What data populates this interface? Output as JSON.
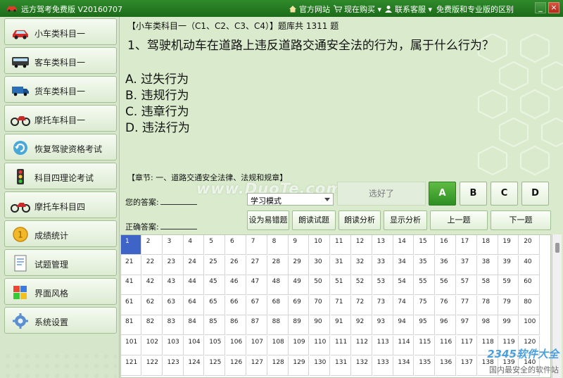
{
  "window": {
    "title": "远方驾考免费版 V20160707",
    "menu": [
      {
        "label": "官方网站",
        "icon": "home-icon"
      },
      {
        "label": "现在购买",
        "icon": "cart-icon"
      },
      {
        "label": "联系客服",
        "icon": "contact-icon"
      },
      {
        "label": "免费版和专业版的区别",
        "icon": ""
      }
    ],
    "controls": {
      "minimize": "_",
      "close": "×"
    }
  },
  "sidebar": {
    "items": [
      {
        "label": "小车类科目一",
        "icon": "car-icon"
      },
      {
        "label": "客车类科目一",
        "icon": "bus-icon"
      },
      {
        "label": "货车类科目一",
        "icon": "truck-icon"
      },
      {
        "label": "摩托车科目一",
        "icon": "motorcycle-icon"
      },
      {
        "label": "恢复驾驶资格考试",
        "icon": "refresh-icon"
      },
      {
        "label": "科目四理论考试",
        "icon": "traffic-light-icon"
      },
      {
        "label": "摩托车科目四",
        "icon": "motorcycle-icon"
      },
      {
        "label": "成绩统计",
        "icon": "medal-icon"
      },
      {
        "label": "试题管理",
        "icon": "document-icon"
      },
      {
        "label": "界面风格",
        "icon": "palette-icon"
      },
      {
        "label": "系统设置",
        "icon": "gear-icon"
      }
    ]
  },
  "question": {
    "header": "【小车类科目一（C1、C2、C3、C4）】题库共 1311 题",
    "text": "1、驾驶机动车在道路上违反道路交通安全法的行为，属于什么行为？",
    "options": [
      "A. 过失行为",
      "B. 违规行为",
      "C. 违章行为",
      "D. 违法行为"
    ],
    "chapter": "【章节: 一、道路交通安全法律、法规和规章】"
  },
  "answer": {
    "your_answer_label": "您的答案:",
    "correct_answer_label": "正确答案:",
    "mode_value": "学习模式",
    "done_label": "选好了",
    "choices": [
      "A",
      "B",
      "C",
      "D"
    ],
    "selected_choice": "A",
    "buttons": {
      "mark_hard": "设为易错题",
      "read_question": "朗读试题",
      "read_analysis": "朗读分析",
      "show_analysis": "显示分析",
      "prev": "上一题",
      "next": "下一题"
    },
    "watermark": "www.DuoTe.com"
  },
  "grid": {
    "columns": 20,
    "visible_from": 1,
    "visible_to": 140,
    "current": 1
  },
  "branding": {
    "name": "2345软件大全",
    "sub": "国内最安全的软件站"
  },
  "colors": {
    "title_bar": "#2f8a2b",
    "selected_choice": "#3f9e2f",
    "current_cell": "#3f64c8"
  }
}
